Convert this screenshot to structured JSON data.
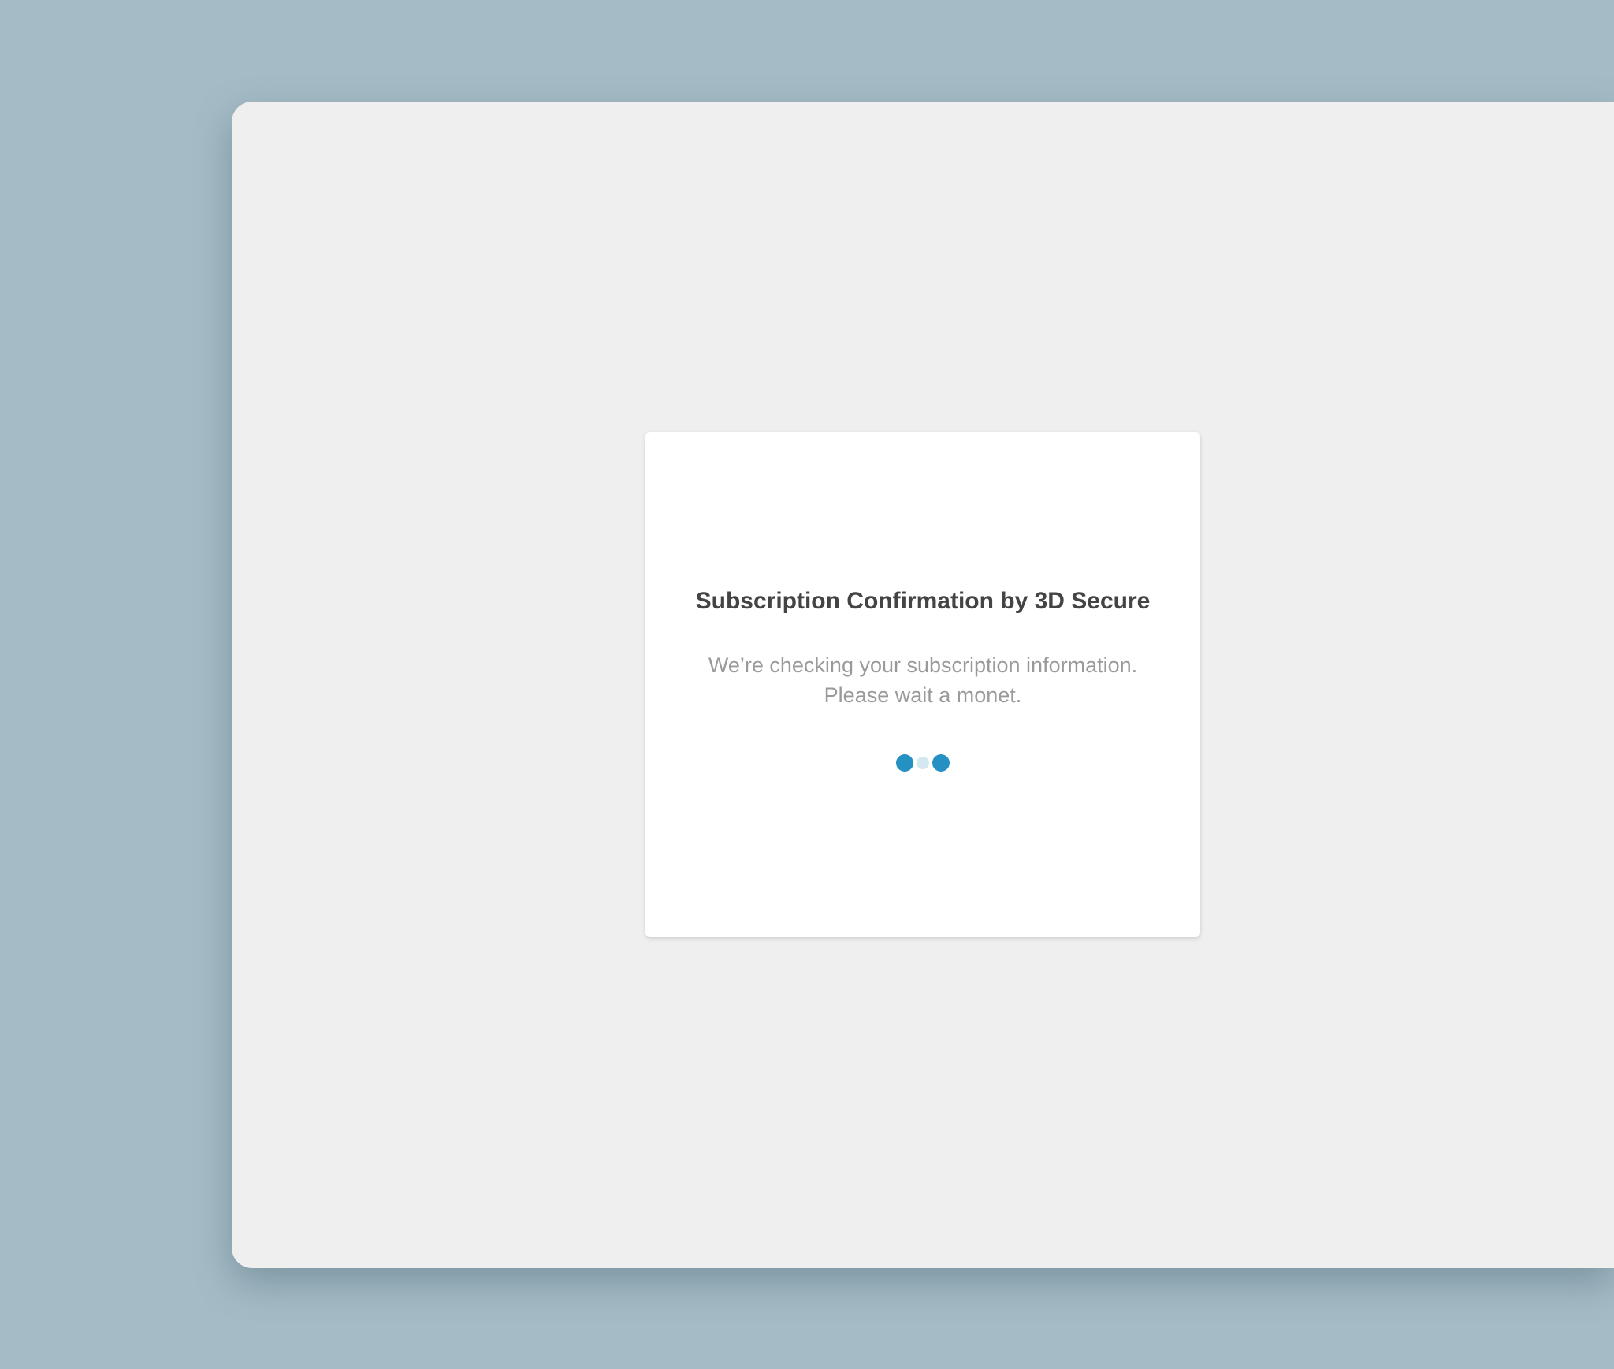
{
  "dialog": {
    "title": "Subscription Confirmation by 3D Secure",
    "message_line1": "We’re checking your subscription information.",
    "message_line2": "Please wait a monet."
  },
  "loading_indicator": {
    "icon": "loading-dots-icon",
    "dots": [
      {
        "state": "active",
        "color": "#2590c2"
      },
      {
        "state": "inactive",
        "color": "#d4e8f1"
      },
      {
        "state": "active",
        "color": "#2590c2"
      }
    ]
  },
  "colors": {
    "background": "#a5bcc6",
    "window": "#efefef",
    "card": "#ffffff",
    "title_text": "#444444",
    "message_text": "#9a9a9a",
    "accent": "#2590c2"
  }
}
